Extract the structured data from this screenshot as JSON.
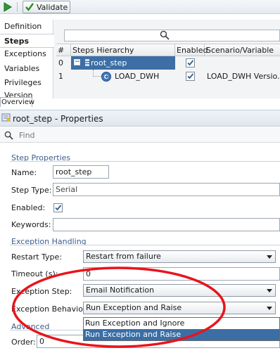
{
  "toolbar": {
    "validate_label": "Validate"
  },
  "left_tabs": {
    "items": [
      "Definition",
      "Steps",
      "Exceptions",
      "Variables",
      "Privileges",
      "Version"
    ],
    "active": "Steps",
    "overview_label": "Overview"
  },
  "steps_grid": {
    "columns": [
      "#",
      "Steps Hierarchy",
      "Enabled",
      "Scenario/Variable"
    ],
    "rows": [
      {
        "num": "0",
        "name": "root_step",
        "enabled": true,
        "scenario": "",
        "expander": "−"
      },
      {
        "num": "1",
        "name": "LOAD_DWH",
        "enabled": true,
        "scenario": "LOAD_DWH Versio..."
      }
    ]
  },
  "properties": {
    "title": "root_step - Properties",
    "find_placeholder": "Find",
    "step_section": "Step Properties",
    "name_label": "Name:",
    "name_value": "root_step",
    "step_type_label": "Step Type:",
    "step_type_value": "Serial",
    "enabled_label": "Enabled:",
    "enabled_value": true,
    "keywords_label": "Keywords:",
    "keywords_value": "",
    "exception_section": "Exception Handling",
    "restart_type_label": "Restart Type:",
    "restart_type_value": "Restart from failure",
    "timeout_label": "Timeout (s):",
    "timeout_value": "0",
    "exception_step_label": "Exception Step:",
    "exception_step_value": "Email Notification",
    "exception_behavior_label": "Exception Behavior:",
    "exception_behavior_value": "Run Exception and Raise",
    "exception_behavior_options": [
      "Run Exception and Ignore",
      "Run Exception and Raise"
    ],
    "advanced_section": "Advanced",
    "order_label": "Order:",
    "order_value": "0"
  },
  "colors": {
    "selection": "#3a6ea5",
    "annotation": "#e8141c",
    "section_text": "#3b5e8c"
  },
  "icons": [
    "run-icon",
    "validate-check-icon",
    "search-icon",
    "tree-expander-icon",
    "step-icon",
    "properties-icon",
    "find-icon"
  ]
}
